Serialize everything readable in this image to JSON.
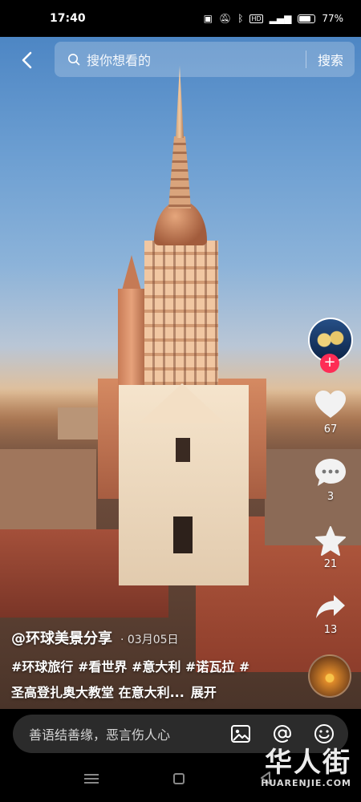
{
  "status_bar": {
    "time": "17:40",
    "icons": [
      "nfc-icon",
      "mute-icon",
      "bluetooth-icon",
      "hd-icon",
      "5g-signal-icon",
      "battery-icon"
    ],
    "battery": "77%"
  },
  "top_bar": {
    "search_placeholder": "搜你想看的",
    "search_button": "搜索"
  },
  "right_rail": {
    "like_count": "67",
    "comment_count": "3",
    "favorite_count": "21",
    "share_count": "13",
    "like_color": "#f2f2f2",
    "follow_color": "#fe2c55"
  },
  "caption": {
    "author": "@环球美景分享",
    "date": "· 03月05日",
    "tags": "#环球旅行 #看世界 #意大利 #诺瓦拉 #",
    "description": "圣高登扎奥大教堂 在意大利...",
    "expand": "展开"
  },
  "comment_bar": {
    "placeholder": "善语结善缘，恶言伤人心",
    "icons": [
      "image-icon",
      "at-icon",
      "emoji-icon"
    ]
  },
  "watermark": {
    "logo": "华人街",
    "text": "HUARENJIE.COM"
  }
}
